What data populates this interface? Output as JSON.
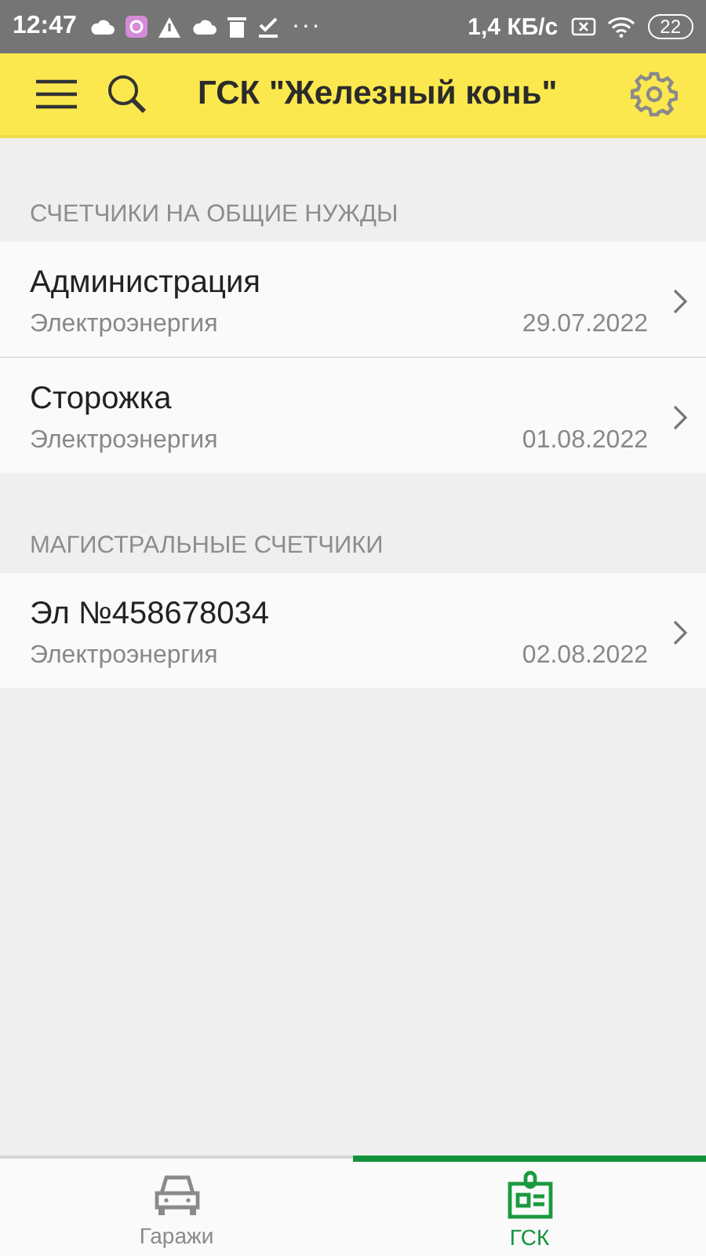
{
  "status_bar": {
    "time": "12:47",
    "more": "···",
    "speed": "1,4 КБ/с",
    "battery": "22"
  },
  "app_bar": {
    "title": "ГСК \"Железный конь\""
  },
  "sections": [
    {
      "header": "СЧЕТЧИКИ НА ОБЩИЕ НУЖДЫ",
      "items": [
        {
          "title": "Администрация",
          "subtitle": "Электроэнергия",
          "date": "29.07.2022"
        },
        {
          "title": "Сторожка",
          "subtitle": "Электроэнергия",
          "date": "01.08.2022"
        }
      ]
    },
    {
      "header": "МАГИСТРАЛЬНЫЕ СЧЕТЧИКИ",
      "items": [
        {
          "title": "Эл №458678034",
          "subtitle": "Электроэнергия",
          "date": "02.08.2022"
        }
      ]
    }
  ],
  "bottom_nav": [
    {
      "kind": "car",
      "label": "Гаражи",
      "selected": false
    },
    {
      "kind": "badge",
      "label": "ГСК",
      "selected": true
    }
  ]
}
